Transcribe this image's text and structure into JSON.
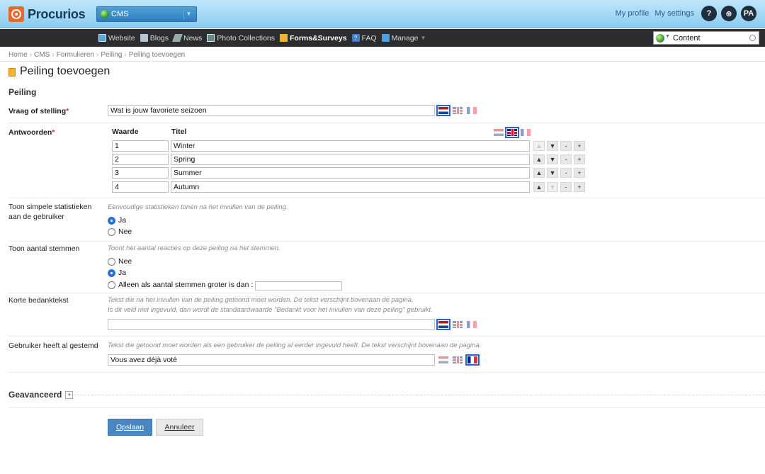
{
  "header": {
    "logo_text": "Procurios",
    "app_select": "CMS",
    "my_profile": "My profile",
    "my_settings": "My settings",
    "help_label": "?",
    "search_label": "⊕",
    "user_initials": "PA"
  },
  "nav": {
    "items": [
      {
        "label": "Website",
        "icon": "website-icon"
      },
      {
        "label": "Blogs",
        "icon": "blogs-icon"
      },
      {
        "label": "News",
        "icon": "news-icon"
      },
      {
        "label": "Photo Collections",
        "icon": "photo-icon"
      },
      {
        "label": "Forms&Surveys",
        "icon": "forms-icon",
        "active": true
      },
      {
        "label": "FAQ",
        "icon": "faq-icon"
      },
      {
        "label": "Manage",
        "icon": "manage-icon"
      }
    ],
    "content_search": "Content"
  },
  "breadcrumb": [
    "Home",
    "CMS",
    "Formulieren",
    "Peiling",
    "Peiling toevoegen"
  ],
  "page": {
    "title": "Peiling toevoegen",
    "section": "Peiling"
  },
  "form": {
    "question": {
      "label": "Vraag of stelling",
      "required": "*",
      "value": "Wat is jouw favoriete seizoen"
    },
    "answers": {
      "label": "Antwoorden",
      "required": "*",
      "col_value": "Waarde",
      "col_title": "Titel",
      "rows": [
        {
          "value": "1",
          "title": "Winter"
        },
        {
          "value": "2",
          "title": "Spring"
        },
        {
          "value": "3",
          "title": "Summer"
        },
        {
          "value": "4",
          "title": "Autumn"
        }
      ],
      "ctrl_up": "▲",
      "ctrl_down": "▼",
      "ctrl_remove": "-",
      "ctrl_add": "+"
    },
    "simple_stats": {
      "label_line1": "Toon simpele statistieken",
      "label_line2": "aan de gebruiker",
      "hint": "Eenvoudige statistieken tonen na het invullen van de peiling.",
      "options": [
        "Ja",
        "Nee"
      ],
      "selected": "Ja"
    },
    "vote_count": {
      "label": "Toon aantal stemmen",
      "hint": "Toont het aantal reacties op deze peiling na het stemmen.",
      "options": [
        "Nee",
        "Ja",
        "Alleen als aantal stemmen groter is dan :"
      ],
      "selected": "Ja",
      "threshold": ""
    },
    "thanks": {
      "label": "Korte bedanktekst",
      "hint_line1": "Tekst die na het invullen van de peiling getoond moet worden. De tekst verschijnt bovenaan de pagina.",
      "hint_line2": "Is dit veld niet ingevuld, dan wordt de standaardwaarde \"Bedankt voor het invullen van deze peiling\" gebruikt.",
      "value": ""
    },
    "already_voted": {
      "label": "Gebruiker heeft al gestemd",
      "hint": "Tekst die getoond moet worden als een gebruiker de peiling al eerder ingevuld heeft. De tekst verschijnt bovenaan de pagina.",
      "value": "Vous avez déjà voté"
    },
    "advanced": {
      "label": "Geavanceerd",
      "toggle": "+"
    },
    "buttons": {
      "save": "Opslaan",
      "cancel": "Annuleer"
    }
  }
}
